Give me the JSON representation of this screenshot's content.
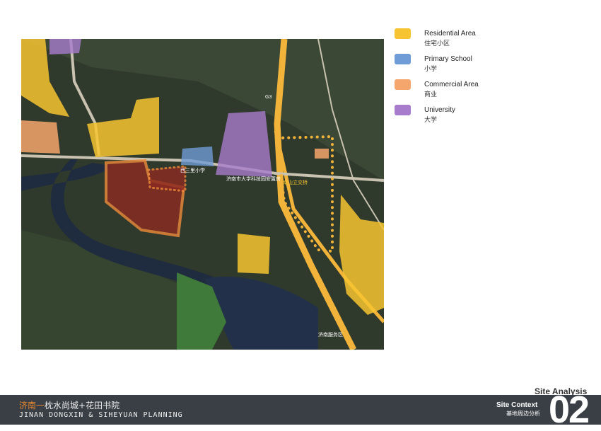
{
  "legend": [
    {
      "en": "Residential Area",
      "cn": "住宅小区",
      "color": "#f7c431"
    },
    {
      "en": "Primary School",
      "cn": "小学",
      "color": "#6f9bd6"
    },
    {
      "en": "Commercial Area",
      "cn": "商业",
      "color": "#f4a66c"
    },
    {
      "en": "University",
      "cn": "大学",
      "color": "#a77ccc"
    }
  ],
  "map": {
    "labels": {
      "resettlement": "济南市大学科技园安置房",
      "bridge": "南山立交桥",
      "service": "济南服务区",
      "school": "西三里小学",
      "highway": "G3"
    }
  },
  "footer": {
    "title_accent": "济南一",
    "title_rest": "枕水尚城+花田书院",
    "subtitle": "JINAN DONGXIN & SIHEYUAN PLANNING",
    "section": "Site Analysis",
    "context_en": "Site Context",
    "context_cn": "基地周边分析",
    "number": "02"
  }
}
